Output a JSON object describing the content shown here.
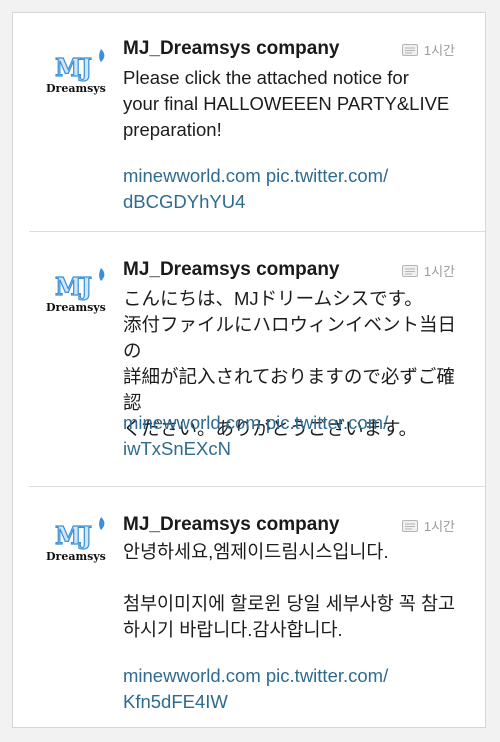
{
  "tweets": [
    {
      "author": "MJ_Dreamsys company",
      "time": "1시간",
      "avatar_text": "MJ",
      "avatar_sub": "Dreamsys",
      "text": "Please click the attached notice for\nyour final HALLOWEEEN PARTY&LIVE\npreparation!",
      "link": "minewworld.com pic.twitter.com/\ndBCGDYhYU4"
    },
    {
      "author": "MJ_Dreamsys company",
      "time": "1시간",
      "avatar_text": "MJ",
      "avatar_sub": "Dreamsys",
      "text": "こんにちは、MJドリームシスです。\n添付ファイルにハロウィンイベント当日の\n詳細が記入されておりますので必ずご確認\nください。ありがとうございます。",
      "link": "minewworld.com pic.twitter.com/\niwTxSnEXcN"
    },
    {
      "author": "MJ_Dreamsys company",
      "time": "1시간",
      "avatar_text": "MJ",
      "avatar_sub": "Dreamsys",
      "text": "안녕하세요,엠제이드림시스입니다.\n\n첨부이미지에 할로윈 당일 세부사항 꼭 참고\n하시기 바랍니다.감사합니다.",
      "link": "minewworld.com pic.twitter.com/\nKfn5dFE4IW"
    }
  ],
  "colors": {
    "link": "#2d6b91",
    "logo_blue": "#3a8fd6",
    "meta": "#9a9a9a"
  },
  "icons": {
    "time": "conversation-icon"
  }
}
